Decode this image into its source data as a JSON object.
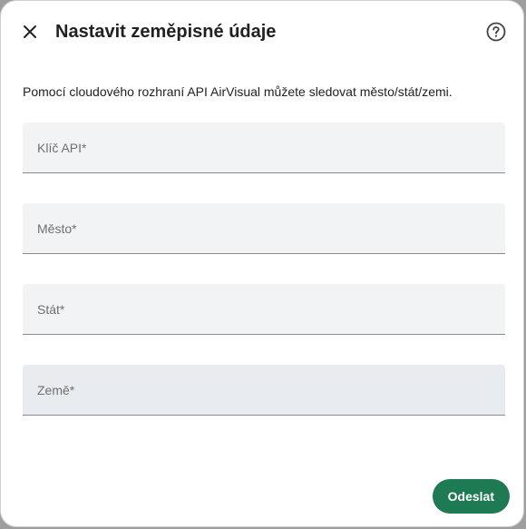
{
  "dialog": {
    "title": "Nastavit zeměpisné údaje",
    "close_icon": "close-icon",
    "help_icon": "help-circle-icon",
    "description": "Pomocí cloudového rozhraní API AirVisual můžete sledovat město/stát/zemi."
  },
  "fields": [
    {
      "placeholder": "Klíč API*",
      "value": ""
    },
    {
      "placeholder": "Město*",
      "value": ""
    },
    {
      "placeholder": "Stát*",
      "value": ""
    },
    {
      "placeholder": "Země*",
      "value": ""
    }
  ],
  "actions": {
    "submit_label": "Odeslat",
    "submit_color": "#1e7a52"
  }
}
